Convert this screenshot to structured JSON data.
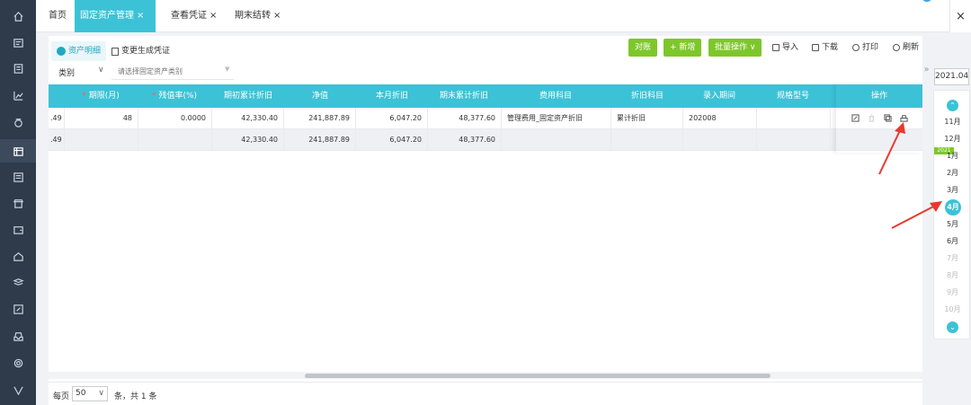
{
  "tabs": [
    {
      "label": "首页",
      "closable": false
    },
    {
      "label": "固定资产管理",
      "closable": true,
      "active": true
    },
    {
      "label": "查看凭证",
      "closable": true
    },
    {
      "label": "期末结转",
      "closable": true
    }
  ],
  "close_symbol": "×",
  "window_close": "×",
  "subtabs": {
    "detail": "资产明细",
    "voucher": "变更生成凭证"
  },
  "toolbar": {
    "reconcile": "对账",
    "add": "+ 新增",
    "batch": "批量操作 ∨",
    "import": "导入",
    "download": "下载",
    "print": "打印",
    "refresh": "刷新"
  },
  "filter": {
    "category_label": "类别",
    "category_arrow": "∨",
    "placeholder": "请选择固定资产类别",
    "search_arrow": "▼"
  },
  "table": {
    "columns": [
      "期限(月)",
      "残值率(%)",
      "期初累计折旧",
      "净值",
      "本月折旧",
      "期末累计折旧",
      "费用科目",
      "折旧科目",
      "录入期间",
      "规格型号",
      "操作"
    ],
    "required_mark": "*",
    "rows": [
      {
        "edge": ".49",
        "term": "48",
        "residual": "0.0000",
        "opening": "42,330.40",
        "net": "241,887.89",
        "month": "6,047.20",
        "closing": "48,377.60",
        "expense": "管理费用_固定资产折旧",
        "depr": "累计折旧",
        "period": "202008",
        "spec": ""
      },
      {
        "edge": ".49",
        "term": "",
        "residual": "",
        "opening": "42,330.40",
        "net": "241,887.89",
        "month": "6,047.20",
        "closing": "48,377.60",
        "expense": "",
        "depr": "",
        "period": "",
        "spec": ""
      }
    ]
  },
  "pager": {
    "per_page_label": "每页",
    "page_size": "50",
    "chev": "∨",
    "count": "条，共 1 条"
  },
  "period_picker": {
    "collapse": "»",
    "year_value": "2021.04",
    "year_tag": "2021",
    "months": [
      "11月",
      "12月",
      "1月",
      "2月",
      "3月",
      "4月",
      "5月",
      "6月",
      "7月",
      "8月",
      "9月",
      "10月"
    ],
    "current_month": "4月",
    "up": "⌃",
    "down": "⌄"
  },
  "colors": {
    "accent": "#3cc2d6",
    "green": "#7ec72b",
    "rail": "#2f3b4b",
    "annotation": "#e8382f"
  }
}
